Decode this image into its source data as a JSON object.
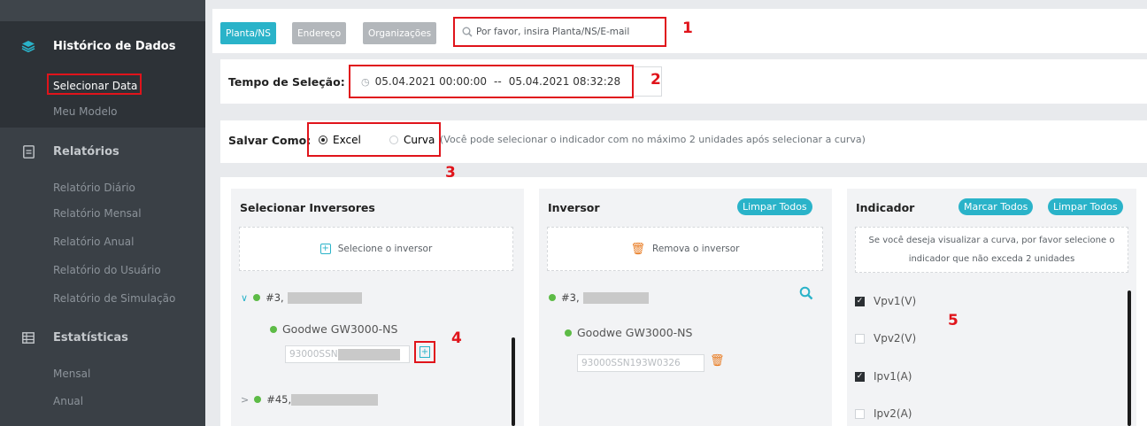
{
  "sidebar": {
    "groups": [
      {
        "title": "Histórico de Dados",
        "icon": "layers-icon",
        "items": [
          "Selecionar Data",
          "Meu Modelo"
        ]
      },
      {
        "title": "Relatórios",
        "icon": "document-icon",
        "items": [
          "Relatório Diário",
          "Relatório Mensal",
          "Relatório Anual",
          "Relatório do Usuário",
          "Relatório de Simulação"
        ]
      },
      {
        "title": "Estatísticas",
        "icon": "table-icon",
        "items": [
          "Mensal",
          "Anual"
        ]
      }
    ],
    "selected_item": "Selecionar Data"
  },
  "search": {
    "tabs": [
      "Planta/NS",
      "Endereço",
      "Organizações"
    ],
    "active_tab": "Planta/NS",
    "placeholder": "Por favor, insira Planta/NS/E-mail"
  },
  "time": {
    "label": "Tempo de Seleção:",
    "start": "05.04.2021 00:00:00",
    "separator": "--",
    "end": "05.04.2021 08:32:28"
  },
  "save": {
    "label": "Salvar Como:",
    "options": [
      "Excel",
      "Curva"
    ],
    "selected": "Excel",
    "hint": "(Você pode selecionar o indicador com no máximo 2 unidades após selecionar a curva)"
  },
  "panels": {
    "select_inverters": {
      "title": "Selecionar Inversores",
      "add_label": "Selecione o inversor",
      "plant1": "#3,",
      "device1": "Goodwe GW3000-NS",
      "sn1": "93000SSN",
      "plant2": "#45,"
    },
    "inverter": {
      "title": "Inversor",
      "clear_label": "Limpar Todos",
      "remove_label": "Remova o inversor",
      "plant1": "#3,",
      "device1": "Goodwe GW3000-NS",
      "sn1": "93000SSN193W0326"
    },
    "indicator": {
      "title": "Indicador",
      "mark_all_label": "Marcar Todos",
      "clear_label": "Limpar Todos",
      "hint_line1": "Se você deseja visualizar a curva, por favor selecione o",
      "hint_line2": "indicador que não exceda 2 unidades",
      "items": [
        {
          "label": "Vpv1(V)",
          "checked": true
        },
        {
          "label": "Vpv2(V)",
          "checked": false
        },
        {
          "label": "Ipv1(A)",
          "checked": true
        },
        {
          "label": "Ipv2(A)",
          "checked": false
        }
      ]
    }
  },
  "annotations": [
    "1",
    "2",
    "3",
    "4",
    "5"
  ],
  "colors": {
    "accent": "#2ab3c9",
    "highlight": "#e0141b",
    "sidebar": "#3a4046",
    "online": "#5dbb46",
    "trash": "#e8791e"
  }
}
